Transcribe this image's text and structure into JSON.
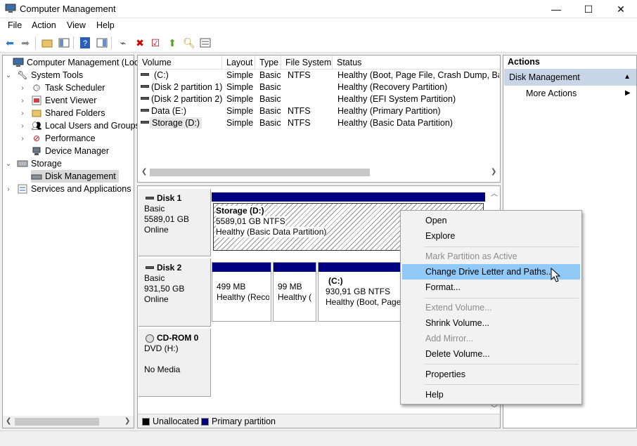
{
  "window": {
    "title": "Computer Management",
    "controls": {
      "minimize": "—",
      "maximize": "☐",
      "close": "✕"
    }
  },
  "menu": [
    "File",
    "Action",
    "View",
    "Help"
  ],
  "tree": {
    "items": [
      {
        "label": "Computer Management (Local",
        "icon": "computer-icon",
        "expander": "",
        "indent": 0
      },
      {
        "label": "System Tools",
        "icon": "tools-icon",
        "expander": "⌄",
        "indent": 1
      },
      {
        "label": "Task Scheduler",
        "icon": "clock-icon",
        "expander": "›",
        "indent": 2
      },
      {
        "label": "Event Viewer",
        "icon": "event-viewer-icon",
        "expander": "›",
        "indent": 2
      },
      {
        "label": "Shared Folders",
        "icon": "shared-folder-icon",
        "expander": "›",
        "indent": 2
      },
      {
        "label": "Local Users and Groups",
        "icon": "users-icon",
        "expander": "›",
        "indent": 2
      },
      {
        "label": "Performance",
        "icon": "performance-icon",
        "expander": "›",
        "indent": 2
      },
      {
        "label": "Device Manager",
        "icon": "device-manager-icon",
        "expander": "",
        "indent": 2
      },
      {
        "label": "Storage",
        "icon": "storage-icon",
        "expander": "⌄",
        "indent": 1
      },
      {
        "label": "Disk Management",
        "icon": "disk-icon",
        "expander": "",
        "indent": 2,
        "selected": true
      },
      {
        "label": "Services and Applications",
        "icon": "services-icon",
        "expander": "›",
        "indent": 1
      }
    ]
  },
  "volume_list": {
    "columns": [
      "Volume",
      "Layout",
      "Type",
      "File System",
      "Status"
    ],
    "rows": [
      [
        "(C:)",
        "Simple",
        "Basic",
        "NTFS",
        "Healthy (Boot, Page File, Crash Dump, Basic"
      ],
      [
        "(Disk 2 partition 1)",
        "Simple",
        "Basic",
        "",
        "Healthy (Recovery Partition)"
      ],
      [
        "(Disk 2 partition 2)",
        "Simple",
        "Basic",
        "",
        "Healthy (EFI System Partition)"
      ],
      [
        "Data (E:)",
        "Simple",
        "Basic",
        "NTFS",
        "Healthy (Primary Partition)"
      ],
      [
        "Storage (D:)",
        "Simple",
        "Basic",
        "NTFS",
        "Healthy (Basic Data Partition)"
      ]
    ]
  },
  "disks": [
    {
      "name": "Disk 1",
      "type": "Basic",
      "size": "5589,01 GB",
      "status": "Online",
      "partitions": [
        {
          "name": "Storage  (D:)",
          "size": "5589,01 GB NTFS",
          "status": "Healthy (Basic Data Partition)"
        }
      ]
    },
    {
      "name": "Disk 2",
      "type": "Basic",
      "size": "931,50 GB",
      "status": "Online",
      "partitions": [
        {
          "name": "",
          "size": "499 MB",
          "status": "Healthy (Reco"
        },
        {
          "name": "",
          "size": "99 MB",
          "status": "Healthy ("
        },
        {
          "name": "(C:)",
          "size": "930,91 GB NTFS",
          "status": "Healthy (Boot, Page F"
        }
      ]
    },
    {
      "name": "CD-ROM 0",
      "type": "DVD (H:)",
      "size": "",
      "status": "No Media",
      "partitions": []
    }
  ],
  "legend": [
    {
      "label": "Unallocated",
      "color": "#000000"
    },
    {
      "label": "Primary partition",
      "color": "#000080"
    }
  ],
  "actions": {
    "header": "Actions",
    "group": "Disk Management",
    "more": "More Actions"
  },
  "context_menu": {
    "items": [
      {
        "label": "Open",
        "enabled": true
      },
      {
        "label": "Explore",
        "enabled": true
      },
      {
        "label": "Mark Partition as Active",
        "enabled": false
      },
      {
        "label": "Change Drive Letter and Paths...",
        "enabled": true,
        "highlighted": true
      },
      {
        "label": "Format...",
        "enabled": true
      },
      {
        "label": "Extend Volume...",
        "enabled": false
      },
      {
        "label": "Shrink Volume...",
        "enabled": true
      },
      {
        "label": "Add Mirror...",
        "enabled": false
      },
      {
        "label": "Delete Volume...",
        "enabled": true
      },
      {
        "label": "Properties",
        "enabled": true
      },
      {
        "label": "Help",
        "enabled": true
      }
    ]
  },
  "colors": {
    "primary_partition": "#000080",
    "highlight": "#91c9f7",
    "action_group": "#c7d5e6"
  }
}
